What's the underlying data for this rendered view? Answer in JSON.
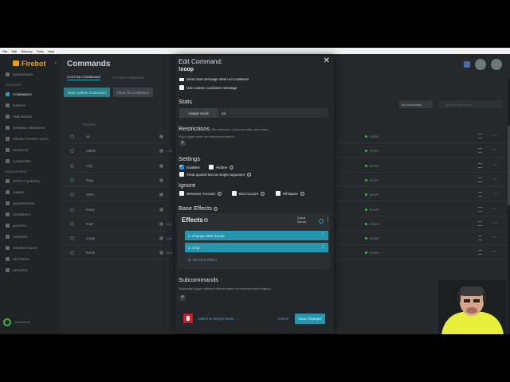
{
  "menubar": [
    "File",
    "Edit",
    "Window",
    "Tools",
    "Help"
  ],
  "app": {
    "name": "Firebot"
  },
  "sidebar": {
    "top_items": [
      {
        "label": "Dashboard"
      }
    ],
    "section_triggers": "Triggers",
    "trigger_items": [
      {
        "label": "Commands",
        "active": true
      },
      {
        "label": "Events"
      },
      {
        "label": "Time-Based"
      },
      {
        "label": "Channel Rewards"
      },
      {
        "label": "Preset Effect Lists"
      },
      {
        "label": "Hotkeys"
      },
      {
        "label": "Counters"
      }
    ],
    "section_management": "Management",
    "management_items": [
      {
        "label": "Effect Queues"
      },
      {
        "label": "Games"
      },
      {
        "label": "Moderation"
      },
      {
        "label": "Currency"
      },
      {
        "label": "Quotes"
      },
      {
        "label": "Viewers"
      },
      {
        "label": "Viewer Roles"
      },
      {
        "label": "Settings"
      },
      {
        "label": "Updates"
      }
    ],
    "connections_label": "Connections"
  },
  "main": {
    "title": "Commands",
    "tabs": [
      "Custom Commands",
      "System Commands"
    ],
    "new_button": "New Custom Command",
    "clear_button": "Clear All Cooldowns",
    "filter_label": "All commands",
    "search_placeholder": "Search commands",
    "trigger_header": "Trigger",
    "rows": [
      {
        "trigger": "!ai",
        "cooldown": "",
        "status": "Active"
      },
      {
        "trigger": "!atfish",
        "cooldown": "?10s",
        "status": "Active"
      },
      {
        "trigger": "!clip",
        "cooldown": "",
        "status": "Active"
      },
      {
        "trigger": "!hug",
        "cooldown": "",
        "status": "Active"
      },
      {
        "trigger": "!retro",
        "cooldown": "",
        "status": "Active"
      },
      {
        "trigger": "!hoity",
        "cooldown": "",
        "status": "Active"
      },
      {
        "trigger": "!hart",
        "cooldown": "120s",
        "status": "Active"
      },
      {
        "trigger": "!coop",
        "cooldown": "120s",
        "status": "Active"
      },
      {
        "trigger": "!hook",
        "cooldown": "120s",
        "status": "Active"
      }
    ]
  },
  "modal": {
    "title": "Edit Command:",
    "command": "!coop",
    "cut_option": "Send chat message when on cooldown",
    "custom_cooldown_option": "Use custom cooldown message",
    "stats_heading": "Stats",
    "usage_label": "Usage count",
    "usage_value": "16",
    "restrictions_heading": "Restrictions",
    "restrictions_note": "(Permissions, currency costs, and more)",
    "restrictions_sub": "Only trigger when all restrictions pass ▾",
    "settings_heading": "Settings",
    "enabled_label": "Enabled",
    "enabled_checked": true,
    "hidden_label": "Hidden",
    "quoted_text_label": "Treat quoted text as single argument",
    "ignore_heading": "Ignore",
    "streamer_label": "Streamer Account",
    "bot_label": "Bot Account",
    "whispers_label": "Whispers",
    "base_effects_heading": "Base Effects",
    "effects_title": "Effects",
    "queue_label": "Queue",
    "queue_value": "Not set",
    "effects": [
      {
        "label": "1. Change OBS Scene"
      },
      {
        "label": "2. Chat"
      }
    ],
    "add_effect": "Add New Effect",
    "subcommands_heading": "Subcommands",
    "subcommands_desc": "Optionally trigger different effects based on subcommand triggers",
    "simple_mode": "Switch to Simple Mode →",
    "cancel": "Cancel",
    "save": "Save Changes"
  }
}
